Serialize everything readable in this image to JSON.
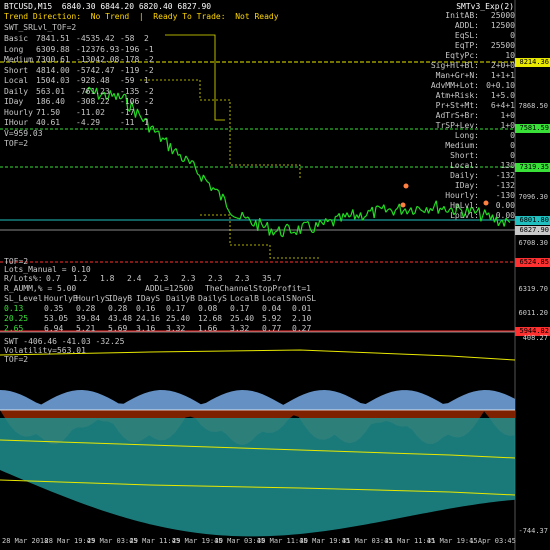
{
  "header": {
    "title": "BTCUSD,M15  6840.30 6844.20 6820.40 6827.90",
    "status": "Trend Direction:  No Trend  |  Ready To Trade:  Not Ready",
    "indicator_name": "SMTv3_Exp(2)"
  },
  "left_panel": {
    "title": "SWT_SRLvl_TOF=2",
    "rows": [
      {
        "name": "Basic",
        "a": "7841.51",
        "b": "-4535.42",
        "c": "-58",
        "d": "2"
      },
      {
        "name": "Long",
        "a": "6309.88",
        "b": "-12376.93",
        "c": "-196",
        "d": "-1"
      },
      {
        "name": "Medium",
        "a": "7300.61",
        "b": "-13042.08",
        "c": "-178",
        "d": "-2"
      },
      {
        "name": "Short",
        "a": "4814.00",
        "b": "-5742.47",
        "c": "-119",
        "d": "-2"
      },
      {
        "name": "Local",
        "a": "1504.03",
        "b": "-928.48",
        "c": "-59",
        "d": "1"
      },
      {
        "name": "Daily",
        "a": "563.01",
        "b": "-761.23",
        "c": "-135",
        "d": "-2"
      },
      {
        "name": "IDay",
        "a": "186.40",
        "b": "-308.22",
        "c": "-106",
        "d": "-2"
      },
      {
        "name": "Hourly",
        "a": "71.50",
        "b": "-11.02",
        "c": "-17",
        "d": "1"
      },
      {
        "name": "IHour",
        "a": "40.61",
        "b": "-4.29",
        "c": "-11",
        "d": "1"
      }
    ],
    "vol_line": "V=959.03",
    "tof_line": "TOF=2"
  },
  "right_panel": {
    "rows": [
      {
        "k": "InitAB:",
        "v": "25000"
      },
      {
        "k": "ADDL:",
        "v": "12500"
      },
      {
        "k": "EqSL:",
        "v": "0"
      },
      {
        "k": "EqTP:",
        "v": "25500"
      },
      {
        "k": "EqtyPc:",
        "v": "10"
      },
      {
        "k": "Sig+Hl+Bl:",
        "v": "2+0+0"
      },
      {
        "k": "Man+Gr+N:",
        "v": "1+1+1"
      },
      {
        "k": "AdvMM+Lot:",
        "v": "0+0.10"
      },
      {
        "k": "Atm+Risk:",
        "v": "1+5.0"
      },
      {
        "k": "Pr+St+Mt:",
        "v": "6+4+1"
      },
      {
        "k": "AdTrS+Br:",
        "v": "1+0"
      },
      {
        "k": "TrSP+Lev:",
        "v": "1+0"
      }
    ],
    "levels": [
      {
        "k": "Long:",
        "v": "0"
      },
      {
        "k": "Medium:",
        "v": "0"
      },
      {
        "k": "Short:",
        "v": "0"
      },
      {
        "k": "Local:",
        "v": "130"
      },
      {
        "k": "Daily:",
        "v": "-132"
      },
      {
        "k": "IDay:",
        "v": "-132"
      },
      {
        "k": "Hourly:",
        "v": "-130"
      },
      {
        "k": "HpLvl:",
        "v": "0.00"
      },
      {
        "k": "LpLvl:",
        "v": "0.00"
      }
    ]
  },
  "bottom_panel": {
    "tof": "TOF=2",
    "lots": "Lots_Manual = 0.10",
    "rlots_label": "R/Lots%:",
    "rlots": [
      "0.7",
      "1.2",
      "1.8",
      "2.4",
      "2.3",
      "2.3",
      "2.3",
      "2.3",
      "35.7"
    ],
    "raumm": "R_AUMM,% = 5.00",
    "addl": "ADDL=12500",
    "channel": "TheChannelStopProfit=1",
    "sl_header": [
      "SL_Level:",
      "HourlyB",
      "HourlyS",
      "IDayB",
      "IDayS",
      "DailyB",
      "DailyS",
      "LocalB",
      "LocalS",
      "NonSL"
    ],
    "sl_row1": [
      "0.13",
      "0.35",
      "0.28",
      "0.28",
      "0.16",
      "0.17",
      "0.08",
      "0.17",
      "0.04",
      "0.01"
    ],
    "sl_row2": [
      "20.25",
      "53.05",
      "39.84",
      "43.48",
      "24.16",
      "25.40",
      "12.68",
      "25.40",
      "5.92",
      "2.10"
    ],
    "sl_row3": [
      "2.65",
      "6.94",
      "5.21",
      "5.69",
      "3.16",
      "3.32",
      "1.66",
      "3.32",
      "0.77",
      "0.27"
    ]
  },
  "price_axis": {
    "ticks": [
      "8214.36",
      "7868.50",
      "7581.59",
      "7319.35",
      "7096.30",
      "6801.80",
      "6827.90",
      "6708.30",
      "6524.85",
      "6319.70",
      "6011.20",
      "5944.82"
    ],
    "boxes": [
      {
        "label": "8214.36",
        "color": "#e8e800"
      },
      {
        "label": "7581.59",
        "color": "#38e038"
      },
      {
        "label": "7319.35",
        "color": "#38e038"
      },
      {
        "label": "6801.80",
        "color": "#20c0c0"
      },
      {
        "label": "6827.90",
        "color": "#c8c8c8"
      },
      {
        "label": "6524.85",
        "color": "#ff3030"
      },
      {
        "label": "5944.82",
        "color": "#ff3030"
      }
    ]
  },
  "sub_panel": {
    "title": "SWT -406.46 -41.03 -32.25",
    "volatility": "Volatility=563.01",
    "tof": "TOF=2",
    "top": "408.27",
    "bottom": "-744.37"
  },
  "x_axis": [
    "28 Mar 2018",
    "28 Mar 19:45",
    "29 Mar 03:45",
    "29 Mar 11:45",
    "29 Mar 19:45",
    "30 Mar 03:45",
    "30 Mar 11:45",
    "30 Mar 19:45",
    "31 Mar 03:45",
    "31 Mar 11:45",
    "31 Mar 19:45",
    "1 Apr 03:45"
  ],
  "chart_data": {
    "type": "line",
    "title": "BTCUSD,M15",
    "ylim": [
      5944.82,
      8214.36
    ],
    "series": [
      {
        "name": "BTCUSD",
        "x": [
          "28 Mar 2018",
          "28 Mar 19:45",
          "29 Mar 03:45",
          "29 Mar 11:45",
          "29 Mar 19:45",
          "30 Mar 03:45",
          "30 Mar 11:45",
          "30 Mar 19:45",
          "31 Mar 03:45",
          "31 Mar 11:45",
          "31 Mar 19:45",
          "1 Apr 03:45"
        ],
        "values": [
          7960,
          7900,
          7550,
          7250,
          6880,
          6760,
          6800,
          6900,
          6950,
          6980,
          6930,
          6830
        ]
      }
    ]
  }
}
